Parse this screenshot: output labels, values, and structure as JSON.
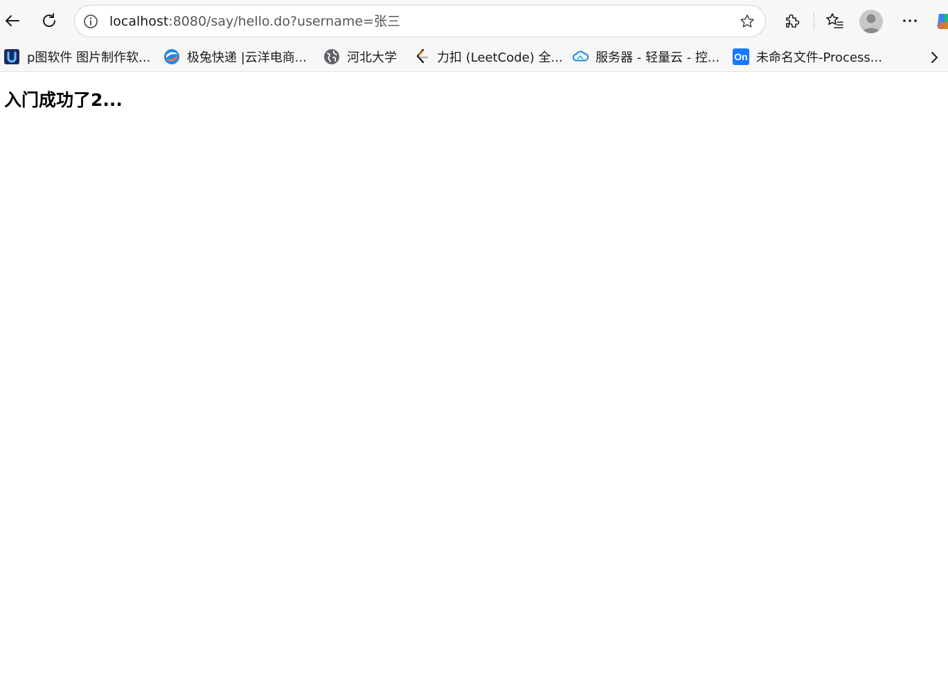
{
  "toolbar": {
    "back_icon": "back-arrow-icon",
    "reload_icon": "reload-icon",
    "address": {
      "host": "localhost",
      "rest": ":8080/say/hello.do?username=张三"
    },
    "extensions_icon": "puzzle-icon",
    "favorites_icon": "favorites-star-list-icon",
    "more_icon": "more-dots-icon"
  },
  "bookmarks": [
    {
      "label": "p图软件 图片制作软...",
      "icon": "blue-u-logo-icon"
    },
    {
      "label": "极兔快递 |云洋电商...",
      "icon": "swirl-logo-icon"
    },
    {
      "label": "河北大学",
      "icon": "globe-icon"
    },
    {
      "label": "力扣 (LeetCode) 全...",
      "icon": "leetcode-icon"
    },
    {
      "label": "服务器 - 轻量云 - 控...",
      "icon": "cloud-icon"
    },
    {
      "label": "未命名文件-Process...",
      "icon": "on-logo-icon",
      "badge": "On"
    }
  ],
  "content": {
    "heading": "入门成功了2..."
  },
  "colors": {
    "toolbar_bg": "#f7f7f7",
    "text": "#1b1b1b",
    "link_blue": "#0f6cbd"
  }
}
